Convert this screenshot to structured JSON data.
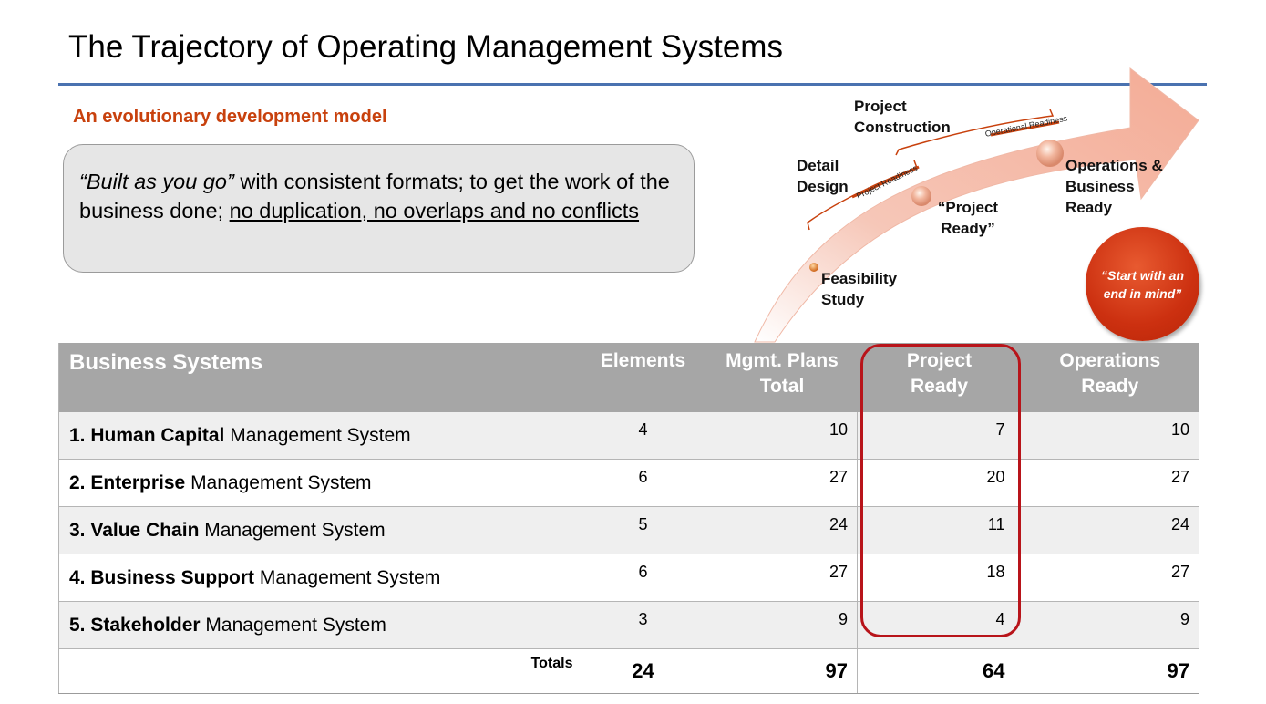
{
  "slide": {
    "title": "The Trajectory of Operating Management Systems",
    "subtitle": "An evolutionary development model",
    "accent_color": "#c8410d",
    "rule_color": "#4a72b0"
  },
  "callout": {
    "lead": "“Built as you go”",
    "text": " with consistent formats; to get the work of the business done; ",
    "underlined": "no duplication, no overlaps and no conflicts"
  },
  "diagram": {
    "stages": {
      "feasibility": "Feasibility Study",
      "detail_design": "Detail Design",
      "project_ready": "“Project Ready”",
      "project_construction": "Project Construction",
      "operations_ready": "Operations & Business Ready"
    },
    "phase_labels": {
      "project_readiness": "Project Readiness",
      "operational_readiness": "Operational Readiness"
    },
    "badge": "“Start with an end in mind”",
    "arrow_color": "#f4b09c",
    "badge_color": "#cc3010"
  },
  "table": {
    "headers": {
      "systems": "Business Systems",
      "elements": "Elements",
      "mgmt_plans": "Mgmt. Plans Total",
      "project_ready": "Project Ready",
      "operations_ready": "Operations Ready"
    },
    "rows": [
      {
        "num": "1.",
        "bold": "Human Capital",
        "rest": " Management System",
        "elements": "4",
        "plans": "10",
        "project_ready": "7",
        "operations_ready": "10"
      },
      {
        "num": "2.",
        "bold": "Enterprise",
        "rest": " Management System",
        "elements": "6",
        "plans": "27",
        "project_ready": "20",
        "operations_ready": "27"
      },
      {
        "num": "3.",
        "bold": "Value Chain",
        "rest": " Management System",
        "elements": "5",
        "plans": "24",
        "project_ready": "11",
        "operations_ready": "24"
      },
      {
        "num": "4.",
        "bold": "Business Support",
        "rest": " Management System",
        "elements": "6",
        "plans": "27",
        "project_ready": "18",
        "operations_ready": "27"
      },
      {
        "num": "5.",
        "bold": "Stakeholder",
        "rest": " Management System",
        "elements": "3",
        "plans": "9",
        "project_ready": "4",
        "operations_ready": "9"
      }
    ],
    "totals": {
      "label": "Totals",
      "elements": "24",
      "plans": "97",
      "project_ready": "64",
      "operations_ready": "97"
    },
    "highlight_color": "#b8141a"
  }
}
